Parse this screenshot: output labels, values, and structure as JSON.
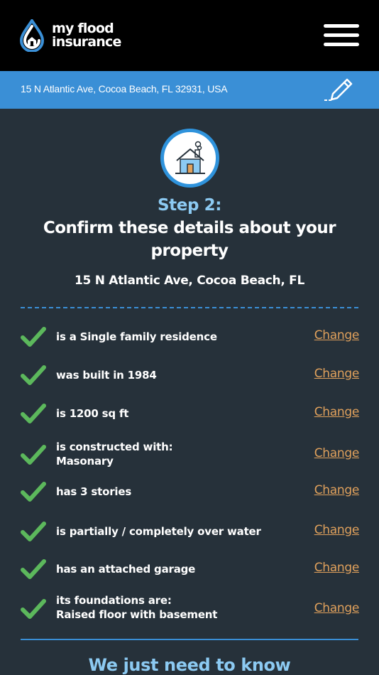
{
  "brand": {
    "logo_line1": "my flood",
    "logo_line2": "insurance",
    "accent_color": "#3a8fd6",
    "link_color": "#e0a15c",
    "check_color": "#5cb85c"
  },
  "header": {
    "menu_icon": "hamburger-menu-icon"
  },
  "address_bar": {
    "address": "15 N Atlantic Ave, Cocoa Beach, FL 32931, USA",
    "edit_icon": "pencil-icon"
  },
  "hero": {
    "icon": "house-icon",
    "step_label": "Step 2:",
    "heading": "Confirm these details about your property",
    "property_address": "15 N Atlantic Ave, Cocoa Beach, FL"
  },
  "details": [
    {
      "text": "is a Single family residence",
      "change_label": "Change"
    },
    {
      "text": "was built in 1984",
      "change_label": "Change"
    },
    {
      "text": "is 1200 sq ft",
      "change_label": "Change"
    },
    {
      "text": "is constructed with:",
      "text2": "Masonary",
      "change_label": "Change"
    },
    {
      "text": "has 3 stories",
      "change_label": "Change"
    },
    {
      "text": "is partially / completely over water",
      "change_label": "Change"
    },
    {
      "text": "has an attached garage",
      "change_label": "Change"
    },
    {
      "text": "its foundations are:",
      "text2": "Raised floor with basement",
      "change_label": "Change"
    }
  ],
  "footer": {
    "heading": "We just need to know"
  }
}
